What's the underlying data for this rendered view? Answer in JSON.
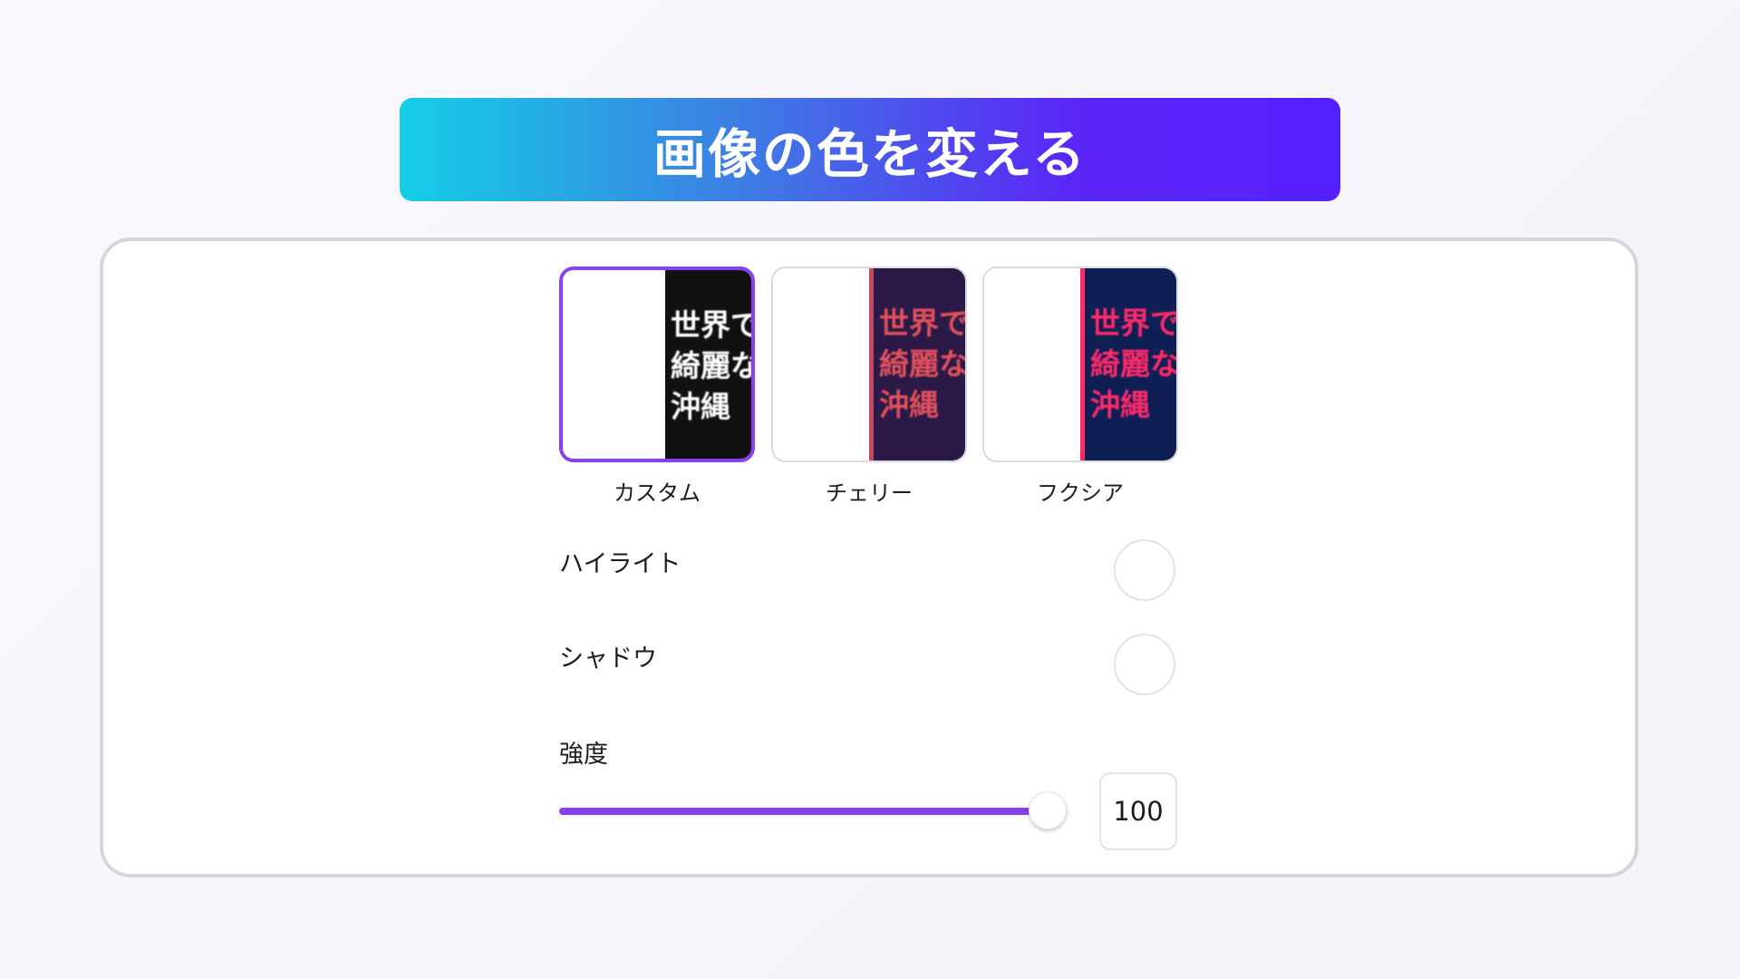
{
  "header": {
    "title": "画像の色を変える"
  },
  "presets": [
    {
      "label": "カスタム",
      "selected": true,
      "preview_lines": [
        "世界で",
        "綺麗な",
        "沖縄"
      ],
      "preview_text_color": "#ffffff",
      "preview_bg_color": "#111111",
      "preview_edge_color": "#111111"
    },
    {
      "label": "チェリー",
      "selected": false,
      "preview_lines": [
        "世界で",
        "綺麗な",
        "沖縄"
      ],
      "preview_text_color": "#e2505c",
      "preview_bg_color": "#2b1a48",
      "preview_edge_color": "#c4465a"
    },
    {
      "label": "フクシア",
      "selected": false,
      "preview_lines": [
        "世界で",
        "綺麗な",
        "沖縄"
      ],
      "preview_text_color": "#ff2a6a",
      "preview_bg_color": "#0e1f54",
      "preview_edge_color": "#ff2a6a"
    }
  ],
  "highlight": {
    "label": "ハイライト",
    "color": "#ffffff"
  },
  "shadow": {
    "label": "シャドウ",
    "color": "#ffffff"
  },
  "intensity": {
    "label": "強度",
    "value": "100",
    "fill_fraction": 1.0
  },
  "colors": {
    "accent": "#8a3ff2",
    "banner_gradient_start": "#14cfe6",
    "banner_gradient_end": "#5520ff"
  }
}
